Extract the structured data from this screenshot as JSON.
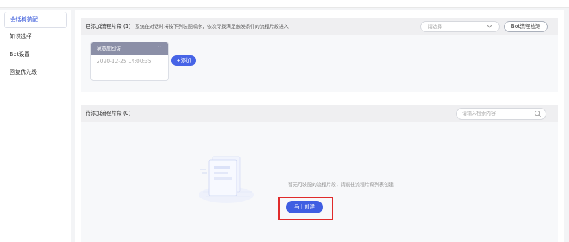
{
  "sidebar": {
    "items": [
      {
        "label": "会话树装配",
        "active": true
      },
      {
        "label": "知识选择",
        "active": false
      },
      {
        "label": "Bot设置",
        "active": false
      },
      {
        "label": "回复优先级",
        "active": false
      }
    ]
  },
  "added_panel": {
    "title": "已添加流程片段 (1)",
    "hint": "系统在对话时将按下列装配顺序，依次寻找满足触发条件的流程片段进入",
    "select_placeholder": "请选择",
    "check_button": "Bot流程检测",
    "card": {
      "name": "满意度回访",
      "time": "2020-12-25 14:00:35"
    },
    "add_button": "+添加"
  },
  "pending_panel": {
    "title": "待添加流程片段 (0)",
    "search_placeholder": "请输入检索内容",
    "empty_text": "暂无可装配的流程片段，请前往流程片段列表创建",
    "create_button": "马上创建"
  },
  "colors": {
    "accent": "#3f5ee2",
    "highlight": "#e02b2b"
  }
}
